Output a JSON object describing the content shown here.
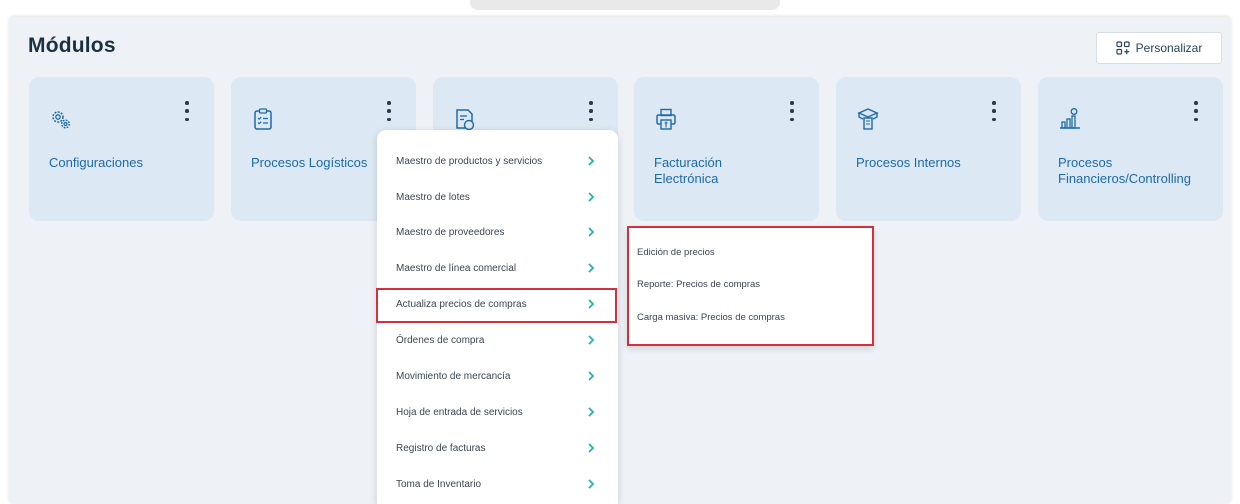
{
  "page": {
    "title": "Módulos",
    "personalize_label": "Personalizar"
  },
  "modules": [
    {
      "label": "Configuraciones",
      "icon": "gears-icon"
    },
    {
      "label": "Procesos Logísticos",
      "icon": "clipboard-list-icon"
    },
    {
      "label": "",
      "icon": "invoice-money-icon"
    },
    {
      "label": "Facturación Electrónica",
      "icon": "printer-money-icon"
    },
    {
      "label": "Procesos Internos",
      "icon": "box-document-icon"
    },
    {
      "label": "Procesos Financieros/Controlling",
      "icon": "bar-chart-growth-icon"
    }
  ],
  "menu": {
    "items": [
      "Maestro de productos y servicios",
      "Maestro de lotes",
      "Maestro de proveedores",
      "Maestro de línea comercial",
      "Actualiza precios de compras",
      "Órdenes de compra",
      "Movimiento de mercancía",
      "Hoja de entrada de servicios",
      "Registro de facturas",
      "Toma de Inventario"
    ],
    "highlighted": "Actualiza precios de compras"
  },
  "submenu": {
    "items": [
      "Edición de precios",
      "Reporte: Precios de compras",
      "Carga masiva: Precios de compras"
    ]
  },
  "colors": {
    "background": "#eef2f6",
    "card": "#dce8f3",
    "accent_blue": "#1e6aa8",
    "chevron_teal": "#1fb8a6",
    "highlight_red": "#d32f3c"
  }
}
